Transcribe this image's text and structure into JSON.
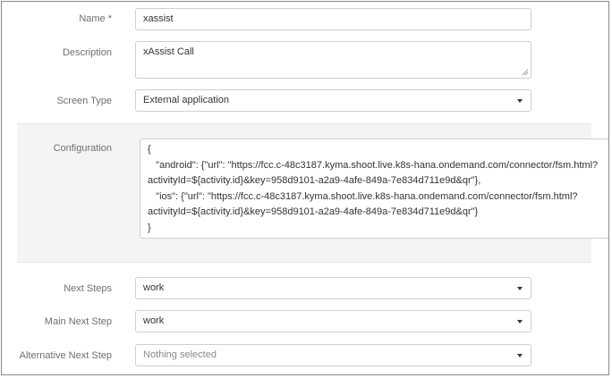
{
  "form": {
    "name": {
      "label": "Name *",
      "value": "xassist"
    },
    "description": {
      "label": "Description",
      "value": "xAssist Call"
    },
    "screen_type": {
      "label": "Screen Type",
      "value": "External application"
    },
    "configuration": {
      "label": "Configuration",
      "lines": [
        "{",
        "   \"android\": {\"url\": \"https://fcc.c-48c3187.kyma.shoot.live.k8s-hana.ondemand.com/connector/fsm.html?",
        "activityId=${activity.id}&key=958d9101-a2a9-4afe-849a-7e834d711e9d&qr\"},",
        "   \"ios\": {\"url\": \"https://fcc.c-48c3187.kyma.shoot.live.k8s-hana.ondemand.com/connector/fsm.html?",
        "activityId=${activity.id}&key=958d9101-a2a9-4afe-849a-7e834d711e9d&qr\"}",
        "}"
      ]
    },
    "next_steps": {
      "label": "Next Steps",
      "value": "work"
    },
    "main_next_step": {
      "label": "Main Next Step",
      "value": "work"
    },
    "alternative_next_step": {
      "label": "Alternative Next Step",
      "placeholder": "Nothing selected"
    }
  },
  "icons": {
    "dropdown": "caret-down-icon",
    "resize": "resize-handle-icon"
  },
  "colors": {
    "label": "#6f6f6f",
    "border": "#cfcfcf",
    "section_bg": "#f4f4f4",
    "placeholder": "#8a8a8a"
  }
}
